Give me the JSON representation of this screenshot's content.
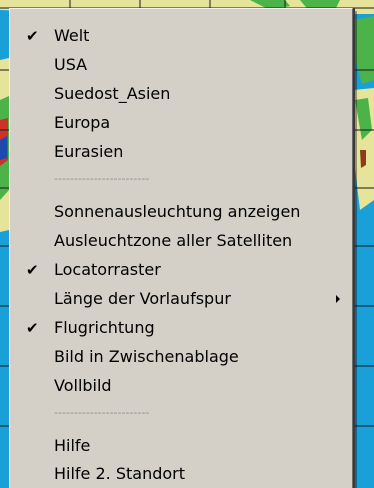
{
  "menu": {
    "group1": [
      {
        "label": "Welt",
        "checked": true
      },
      {
        "label": "USA",
        "checked": false
      },
      {
        "label": "Suedost_Asien",
        "checked": false
      },
      {
        "label": "Europa",
        "checked": false
      },
      {
        "label": "Eurasien",
        "checked": false
      }
    ],
    "separator1": "------------------------",
    "group2": [
      {
        "label": "Sonnenausleuchtung anzeigen",
        "checked": false
      },
      {
        "label": "Ausleuchtzone aller Satelliten",
        "checked": false
      },
      {
        "label": "Locatorraster",
        "checked": true
      },
      {
        "label": "Länge der Vorlaufspur",
        "checked": false,
        "submenu": true
      },
      {
        "label": "Flugrichtung",
        "checked": true
      },
      {
        "label": "Bild in Zwischenablage",
        "checked": false
      },
      {
        "label": "Vollbild",
        "checked": false
      }
    ],
    "separator2": "------------------------",
    "group3": [
      {
        "label": "Hilfe",
        "checked": false
      },
      {
        "label": "Hilfe 2. Standort",
        "checked": false
      }
    ],
    "check_glyph": "✔"
  },
  "colors": {
    "menu_bg": "#d4d0c8",
    "map_ocean": "#1aa0d8",
    "map_land": "#e8e6a0"
  }
}
